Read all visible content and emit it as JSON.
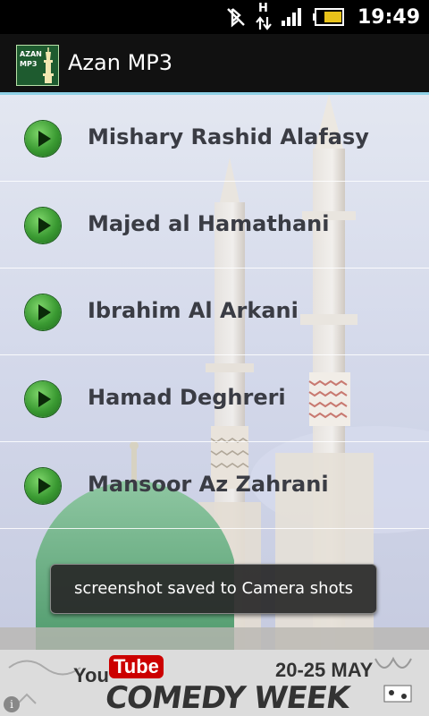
{
  "status_bar": {
    "time": "19:49",
    "network_type": "H",
    "icons": [
      "bluetooth-off-icon",
      "hsdpa-data-icon",
      "signal-strength-icon",
      "battery-icon"
    ]
  },
  "app": {
    "title": "Azan MP3",
    "logo_text": "AZAN MP3",
    "logo_icon": "minaret-icon"
  },
  "reciters": [
    {
      "name": "Mishary Rashid Alafasy",
      "icon": "play-icon"
    },
    {
      "name": "Majed al Hamathani",
      "icon": "play-icon"
    },
    {
      "name": "Ibrahim Al Arkani",
      "icon": "play-icon"
    },
    {
      "name": "Hamad Deghreri",
      "icon": "play-icon"
    },
    {
      "name": "Mansoor Az Zahrani",
      "icon": "play-icon"
    }
  ],
  "toast": {
    "message": "screenshot saved to Camera shots"
  },
  "ad_banner": {
    "brand_you": "You",
    "brand_tube": "Tube",
    "headline": "COMEDY WEEK",
    "dates": "20-25 MAY",
    "info_icon": "info-icon"
  },
  "colors": {
    "title_bar_bg": "#111111",
    "title_bar_accent": "#8fd1e6",
    "play_button": "#3a9a32",
    "reciter_text": "#3a3c44",
    "youtube_red": "#cc0000"
  }
}
